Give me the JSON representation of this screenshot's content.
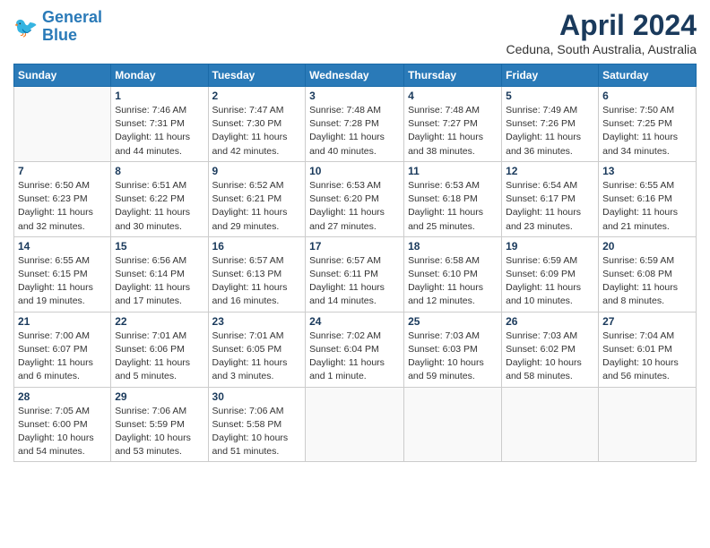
{
  "header": {
    "logo_line1": "General",
    "logo_line2": "Blue",
    "month_title": "April 2024",
    "location": "Ceduna, South Australia, Australia"
  },
  "weekdays": [
    "Sunday",
    "Monday",
    "Tuesday",
    "Wednesday",
    "Thursday",
    "Friday",
    "Saturday"
  ],
  "weeks": [
    [
      {
        "day": "",
        "info": ""
      },
      {
        "day": "1",
        "info": "Sunrise: 7:46 AM\nSunset: 7:31 PM\nDaylight: 11 hours\nand 44 minutes."
      },
      {
        "day": "2",
        "info": "Sunrise: 7:47 AM\nSunset: 7:30 PM\nDaylight: 11 hours\nand 42 minutes."
      },
      {
        "day": "3",
        "info": "Sunrise: 7:48 AM\nSunset: 7:28 PM\nDaylight: 11 hours\nand 40 minutes."
      },
      {
        "day": "4",
        "info": "Sunrise: 7:48 AM\nSunset: 7:27 PM\nDaylight: 11 hours\nand 38 minutes."
      },
      {
        "day": "5",
        "info": "Sunrise: 7:49 AM\nSunset: 7:26 PM\nDaylight: 11 hours\nand 36 minutes."
      },
      {
        "day": "6",
        "info": "Sunrise: 7:50 AM\nSunset: 7:25 PM\nDaylight: 11 hours\nand 34 minutes."
      }
    ],
    [
      {
        "day": "7",
        "info": "Sunrise: 6:50 AM\nSunset: 6:23 PM\nDaylight: 11 hours\nand 32 minutes."
      },
      {
        "day": "8",
        "info": "Sunrise: 6:51 AM\nSunset: 6:22 PM\nDaylight: 11 hours\nand 30 minutes."
      },
      {
        "day": "9",
        "info": "Sunrise: 6:52 AM\nSunset: 6:21 PM\nDaylight: 11 hours\nand 29 minutes."
      },
      {
        "day": "10",
        "info": "Sunrise: 6:53 AM\nSunset: 6:20 PM\nDaylight: 11 hours\nand 27 minutes."
      },
      {
        "day": "11",
        "info": "Sunrise: 6:53 AM\nSunset: 6:18 PM\nDaylight: 11 hours\nand 25 minutes."
      },
      {
        "day": "12",
        "info": "Sunrise: 6:54 AM\nSunset: 6:17 PM\nDaylight: 11 hours\nand 23 minutes."
      },
      {
        "day": "13",
        "info": "Sunrise: 6:55 AM\nSunset: 6:16 PM\nDaylight: 11 hours\nand 21 minutes."
      }
    ],
    [
      {
        "day": "14",
        "info": "Sunrise: 6:55 AM\nSunset: 6:15 PM\nDaylight: 11 hours\nand 19 minutes."
      },
      {
        "day": "15",
        "info": "Sunrise: 6:56 AM\nSunset: 6:14 PM\nDaylight: 11 hours\nand 17 minutes."
      },
      {
        "day": "16",
        "info": "Sunrise: 6:57 AM\nSunset: 6:13 PM\nDaylight: 11 hours\nand 16 minutes."
      },
      {
        "day": "17",
        "info": "Sunrise: 6:57 AM\nSunset: 6:11 PM\nDaylight: 11 hours\nand 14 minutes."
      },
      {
        "day": "18",
        "info": "Sunrise: 6:58 AM\nSunset: 6:10 PM\nDaylight: 11 hours\nand 12 minutes."
      },
      {
        "day": "19",
        "info": "Sunrise: 6:59 AM\nSunset: 6:09 PM\nDaylight: 11 hours\nand 10 minutes."
      },
      {
        "day": "20",
        "info": "Sunrise: 6:59 AM\nSunset: 6:08 PM\nDaylight: 11 hours\nand 8 minutes."
      }
    ],
    [
      {
        "day": "21",
        "info": "Sunrise: 7:00 AM\nSunset: 6:07 PM\nDaylight: 11 hours\nand 6 minutes."
      },
      {
        "day": "22",
        "info": "Sunrise: 7:01 AM\nSunset: 6:06 PM\nDaylight: 11 hours\nand 5 minutes."
      },
      {
        "day": "23",
        "info": "Sunrise: 7:01 AM\nSunset: 6:05 PM\nDaylight: 11 hours\nand 3 minutes."
      },
      {
        "day": "24",
        "info": "Sunrise: 7:02 AM\nSunset: 6:04 PM\nDaylight: 11 hours\nand 1 minute."
      },
      {
        "day": "25",
        "info": "Sunrise: 7:03 AM\nSunset: 6:03 PM\nDaylight: 10 hours\nand 59 minutes."
      },
      {
        "day": "26",
        "info": "Sunrise: 7:03 AM\nSunset: 6:02 PM\nDaylight: 10 hours\nand 58 minutes."
      },
      {
        "day": "27",
        "info": "Sunrise: 7:04 AM\nSunset: 6:01 PM\nDaylight: 10 hours\nand 56 minutes."
      }
    ],
    [
      {
        "day": "28",
        "info": "Sunrise: 7:05 AM\nSunset: 6:00 PM\nDaylight: 10 hours\nand 54 minutes."
      },
      {
        "day": "29",
        "info": "Sunrise: 7:06 AM\nSunset: 5:59 PM\nDaylight: 10 hours\nand 53 minutes."
      },
      {
        "day": "30",
        "info": "Sunrise: 7:06 AM\nSunset: 5:58 PM\nDaylight: 10 hours\nand 51 minutes."
      },
      {
        "day": "",
        "info": ""
      },
      {
        "day": "",
        "info": ""
      },
      {
        "day": "",
        "info": ""
      },
      {
        "day": "",
        "info": ""
      }
    ]
  ]
}
